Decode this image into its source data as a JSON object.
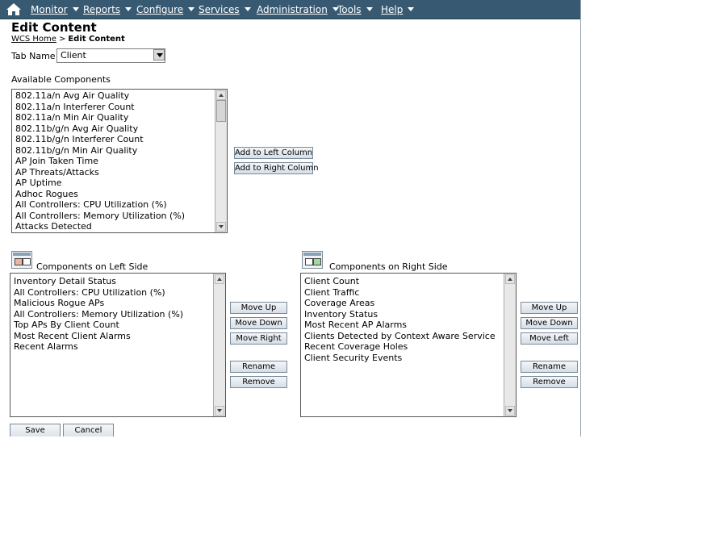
{
  "nav": {
    "items": [
      {
        "label": "Monitor"
      },
      {
        "label": "Reports"
      },
      {
        "label": "Configure"
      },
      {
        "label": "Services"
      },
      {
        "label": "Administration"
      },
      {
        "label": "Tools"
      },
      {
        "label": "Help"
      }
    ]
  },
  "page": {
    "title": "Edit Content",
    "breadcrumb_home": "WCS Home",
    "breadcrumb_sep": ">",
    "breadcrumb_current": "Edit Content"
  },
  "tab": {
    "label": "Tab Name",
    "selected": "Client"
  },
  "available": {
    "label": "Available Components",
    "items": [
      "802.11a/n Avg Air Quality",
      "802.11a/n Interferer Count",
      "802.11a/n Min Air Quality",
      "802.11b/g/n Avg Air Quality",
      "802.11b/g/n Interferer Count",
      "802.11b/g/n Min Air Quality",
      "AP Join Taken Time",
      "AP Threats/Attacks",
      "AP Uptime",
      "Adhoc Rogues",
      "All Controllers: CPU Utilization (%)",
      "All Controllers: Memory Utilization (%)",
      "Attacks Detected"
    ],
    "add_left": "Add to Left Column",
    "add_right": "Add to Right Column"
  },
  "left": {
    "label": "Components on Left Side",
    "items": [
      "Inventory Detail Status",
      "All Controllers: CPU Utilization (%)",
      "Malicious Rogue APs",
      "All Controllers: Memory Utilization (%)",
      "Top APs By Client Count",
      "Most Recent Client Alarms",
      "Recent Alarms"
    ],
    "move_up": "Move Up",
    "move_down": "Move Down",
    "move_side": "Move Right",
    "rename": "Rename",
    "remove": "Remove"
  },
  "right": {
    "label": "Components on Right Side",
    "items": [
      "Client Count",
      "Client Traffic",
      "Coverage Areas",
      "Inventory Status",
      "Most Recent AP Alarms",
      "Clients Detected by Context Aware Service",
      "Recent Coverage Holes",
      "Client Security Events"
    ],
    "move_up": "Move Up",
    "move_down": "Move Down",
    "move_side": "Move Left",
    "rename": "Rename",
    "remove": "Remove"
  },
  "footer": {
    "save": "Save",
    "cancel": "Cancel"
  },
  "colors": {
    "navbar": "#375a72"
  }
}
